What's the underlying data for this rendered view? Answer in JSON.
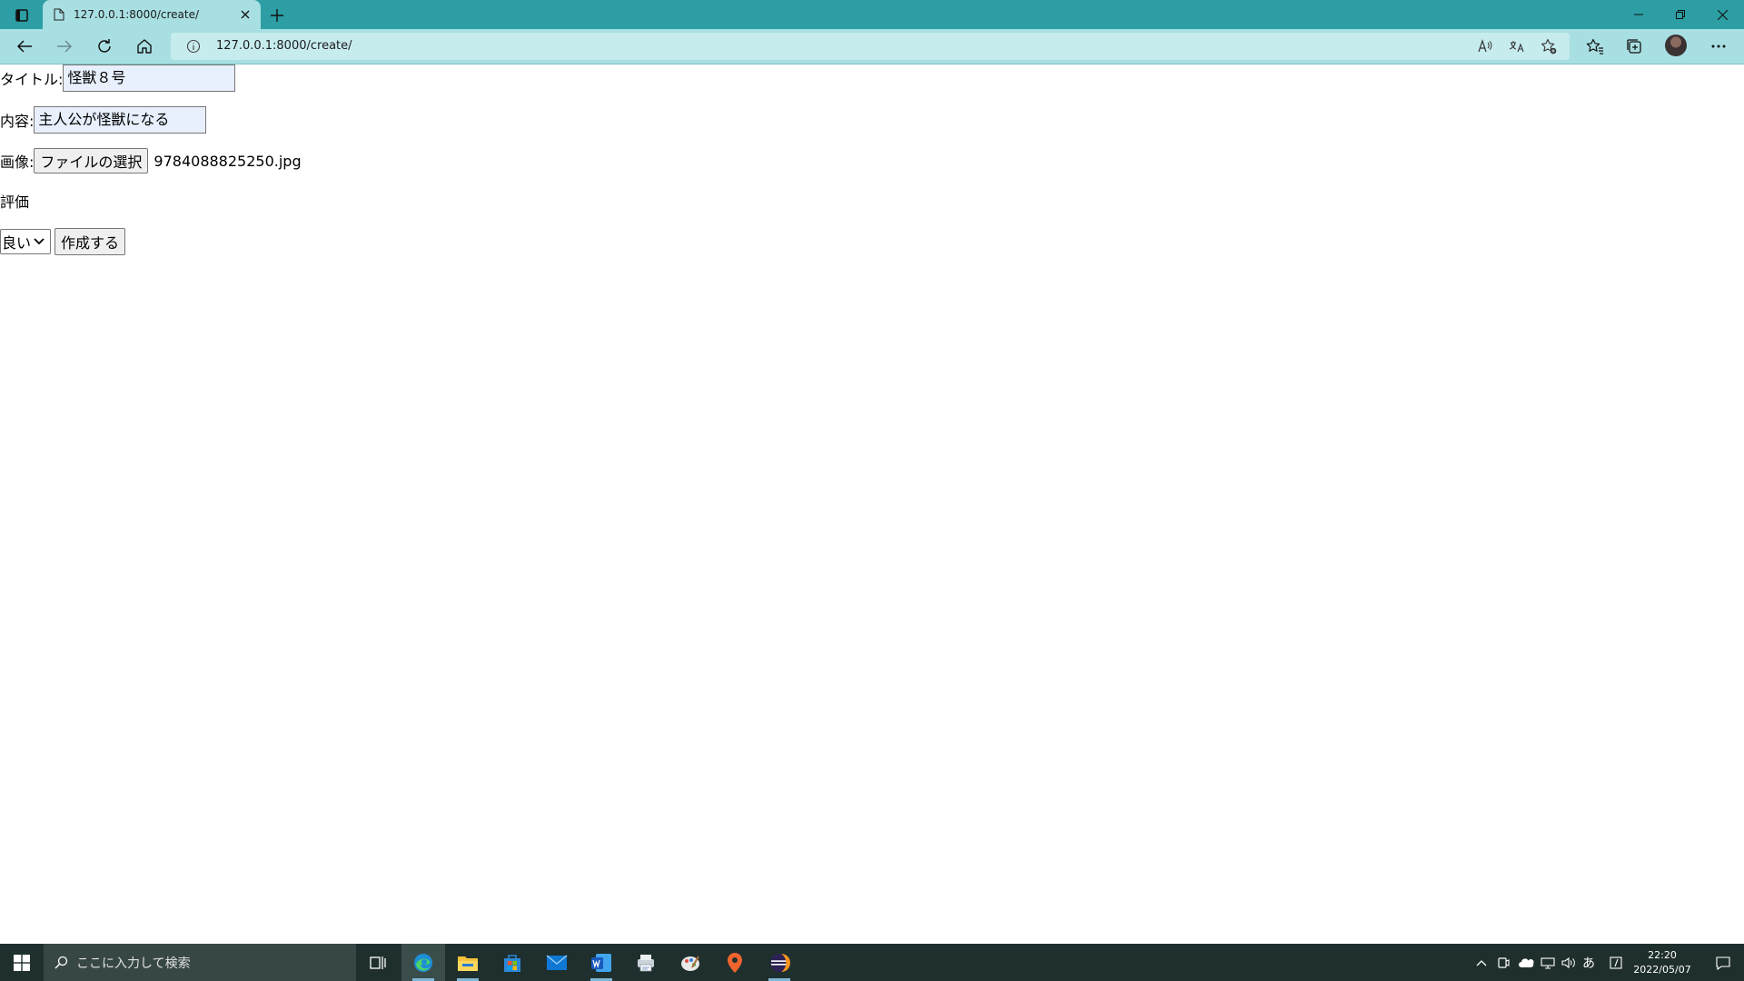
{
  "browser": {
    "tab_title": "127.0.0.1:8000/create/",
    "url": "127.0.0.1:8000/create/"
  },
  "form": {
    "title_label": "タイトル:",
    "title_value": "怪獣８号",
    "content_label": "内容:",
    "content_value": "主人公が怪獣になる",
    "image_label": "画像:",
    "file_button": "ファイルの選択",
    "file_name": "9784088825250.jpg",
    "rating_label": "評価",
    "rating_selected": "良い",
    "submit_label": "作成する"
  },
  "taskbar": {
    "search_placeholder": "ここに入力して検索",
    "ime_indicator": "あ",
    "time": "22:20",
    "date": "2022/05/07"
  },
  "colors": {
    "titlebar": "#2c9ea4",
    "toolbar": "#a8dfe2",
    "taskbar": "#1f2f2e"
  }
}
